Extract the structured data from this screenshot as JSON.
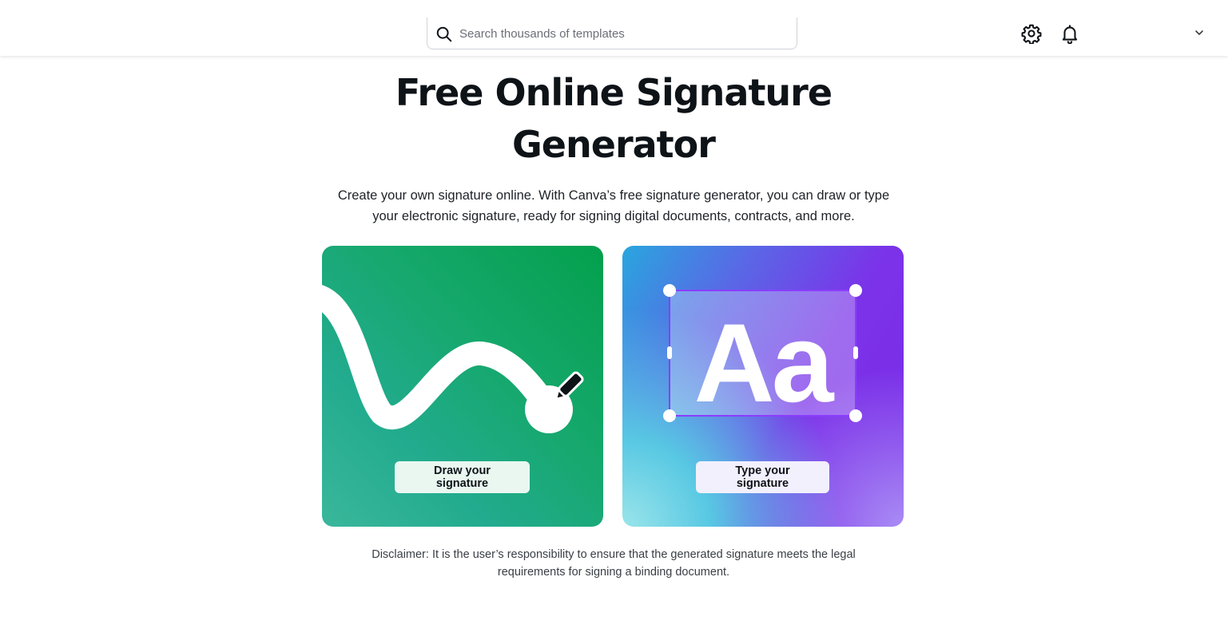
{
  "header": {
    "search": {
      "placeholder": "Search thousands of templates",
      "value": ""
    },
    "icons": [
      "search-icon",
      "gear-icon",
      "bell-icon",
      "chevron-down-icon"
    ]
  },
  "hero": {
    "title_line1": "Free Online Signature",
    "title_line2": "Generator",
    "subtitle_line1": "Create your own signature online. With Canva’s free signature generator, you can draw or type",
    "subtitle_line2": "your electronic signature, ready for signing digital documents, contracts, and more."
  },
  "cards": {
    "draw": {
      "label": "Draw your signature",
      "icon": "pen-icon"
    },
    "type": {
      "label": "Type your signature",
      "glyph": "Aa"
    }
  },
  "disclaimer": {
    "line1": "Disclaimer: It is the user’s responsibility to ensure that the generated signature meets the legal",
    "line2": "requirements for signing a binding document."
  },
  "colors": {
    "draw_card": "#04a04d",
    "type_card": "#7b33e9",
    "text": "#0e1318",
    "selection": "#8b3dff"
  }
}
